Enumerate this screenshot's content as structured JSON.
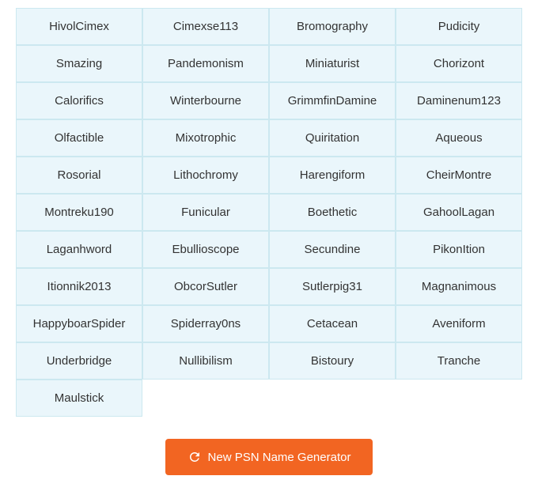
{
  "grid": {
    "rows": [
      [
        "HivolCimex",
        "Cimexse113",
        "Bromography",
        "Pudicity"
      ],
      [
        "Smazing",
        "Pandemonism",
        "Miniaturist",
        "Chorizont"
      ],
      [
        "Calorifics",
        "Winterbourne",
        "GrimmfinDamine",
        "Daminenum123"
      ],
      [
        "Olfactible",
        "Mixotrophic",
        "Quiritation",
        "Aqueous"
      ],
      [
        "Rosorial",
        "Lithochromy",
        "Harengiform",
        "CheirMontre"
      ],
      [
        "Montreku190",
        "Funicular",
        "Boethetic",
        "GahoolLagan"
      ],
      [
        "Laganhword",
        "Ebullioscope",
        "Secundine",
        "PikonItion"
      ],
      [
        "Itionnik2013",
        "ObcorSutler",
        "Sutlerpig31",
        "Magnanimous"
      ],
      [
        "HappyboarSpider",
        "Spiderray0ns",
        "Cetacean",
        "Aveniform"
      ],
      [
        "Underbridge",
        "Nullibilism",
        "Bistoury",
        "Tranche"
      ],
      [
        "Maulstick",
        "",
        "",
        ""
      ]
    ]
  },
  "button": {
    "label": "New PSN Name Generator",
    "icon": "refresh-icon"
  }
}
